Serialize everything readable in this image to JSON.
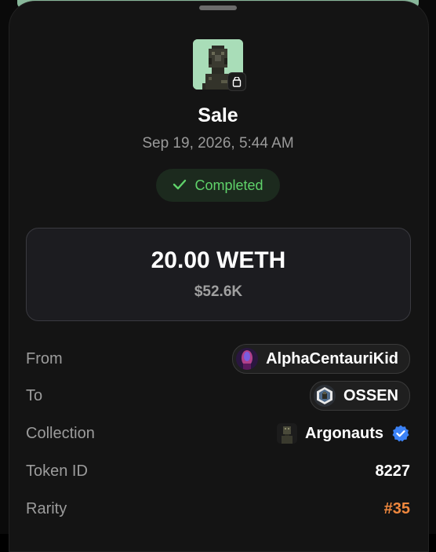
{
  "title": "Sale",
  "date": "Sep 19, 2026, 5:44 AM",
  "status": {
    "label": "Completed",
    "icon": "checkmark-icon",
    "color": "#5fd26a"
  },
  "price": {
    "amount": "20.00 WETH",
    "usd": "$52.6K"
  },
  "details": [
    {
      "label": "From",
      "value": "AlphaCentauriKid"
    },
    {
      "label": "To",
      "value": "OSSEN"
    },
    {
      "label": "Collection",
      "value": "Argonauts"
    },
    {
      "label": "Token ID",
      "value": "8227"
    },
    {
      "label": "Rarity",
      "value": "#35"
    }
  ],
  "colors": {
    "rarity": "#f0883e",
    "verified": "#3b82f6",
    "thumb_bg": "#a9ddb8"
  },
  "icons": {
    "thumb_badge": "shopping-bag-icon",
    "verified": "verified-badge-icon"
  }
}
